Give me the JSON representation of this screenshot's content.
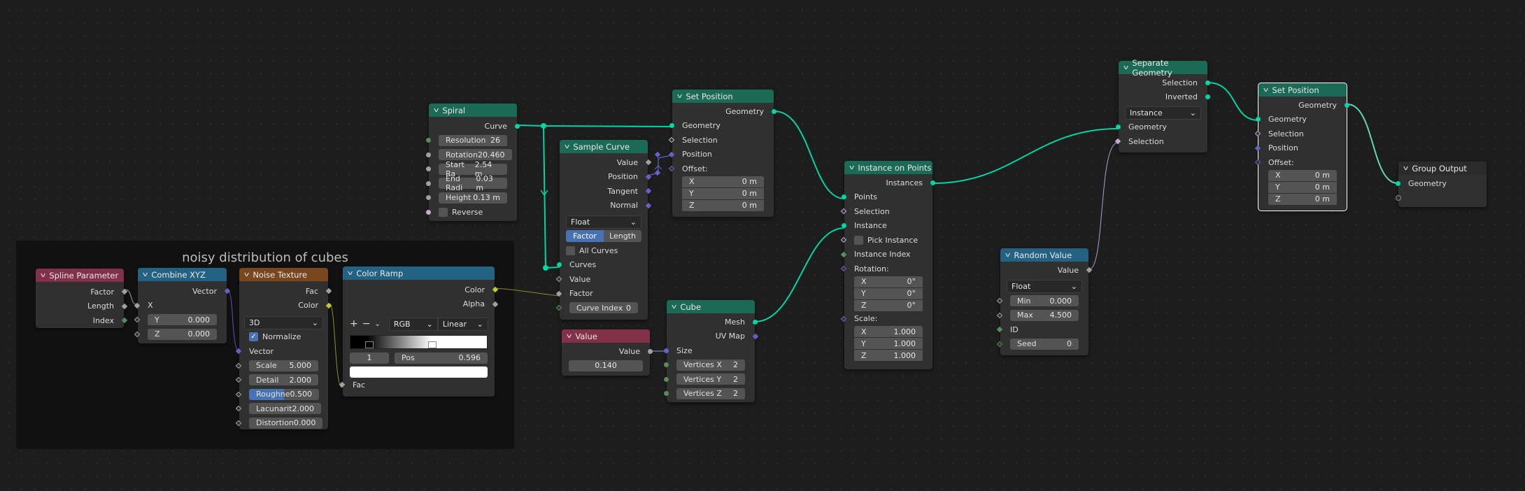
{
  "frame": {
    "label": "noisy distribution of cubes"
  },
  "colors": {
    "geometry_socket": "#00d6a3",
    "vector_socket": "#6363c7",
    "float_socket": "#a1a1a1",
    "int_socket": "#598c5c",
    "bool_socket": "#cca6d6",
    "color_socket": "#c7c729",
    "geometry_header": "#1b6a56",
    "input_header": "#83314a",
    "converter_header": "#246283",
    "texture_header": "#79461d",
    "accent": "#4772b3"
  },
  "nodes": {
    "spline_parameter": {
      "title": "Spline Parameter",
      "outputs": [
        "Factor",
        "Length",
        "Index"
      ]
    },
    "combine_xyz": {
      "title": "Combine XYZ",
      "output": "Vector",
      "x_label": "X",
      "fields": [
        {
          "label": "Y",
          "value": "0.000"
        },
        {
          "label": "Z",
          "value": "0.000"
        }
      ]
    },
    "noise_texture": {
      "title": "Noise Texture",
      "outputs": [
        "Fac",
        "Color"
      ],
      "dimensions": "3D",
      "normalize_label": "Normalize",
      "normalize": true,
      "vector_label": "Vector",
      "fields": [
        {
          "label": "Scale",
          "value": "5.000"
        },
        {
          "label": "Detail",
          "value": "2.000"
        },
        {
          "label": "Roughne",
          "value": "0.500"
        },
        {
          "label": "Lacunarit",
          "value": "2.000"
        },
        {
          "label": "Distortion",
          "value": "0.000"
        }
      ]
    },
    "color_ramp": {
      "title": "Color Ramp",
      "outputs": [
        "Color",
        "Alpha"
      ],
      "add": "+",
      "remove": "−",
      "color_mode": "RGB",
      "interpolation": "Linear",
      "stop_index": "1",
      "pos_label": "Pos",
      "pos_value": "0.596",
      "stops": [
        0.12,
        0.596
      ],
      "input": "Fac"
    },
    "spiral": {
      "title": "Spiral",
      "output": "Curve",
      "fields": [
        {
          "label": "Resolution",
          "value": "26"
        },
        {
          "label": "Rotation",
          "value": "20.460"
        },
        {
          "label": "Start Ra",
          "value": "2.54 m"
        },
        {
          "label": "End Radi",
          "value": "0.03 m"
        },
        {
          "label": "Height",
          "value": "0.13 m"
        }
      ],
      "reverse_label": "Reverse",
      "reverse": false
    },
    "sample_curve": {
      "title": "Sample Curve",
      "outputs": [
        "Value",
        "Position",
        "Tangent",
        "Normal"
      ],
      "data_type": "Float",
      "modes": [
        "Factor",
        "Length"
      ],
      "active_mode": "Factor",
      "all_curves_label": "All Curves",
      "all_curves": false,
      "inputs": [
        "Curves",
        "Value",
        "Factor"
      ],
      "curve_index_label": "Curve Index",
      "curve_index": "0"
    },
    "value": {
      "title": "Value",
      "output": "Value",
      "value": "0.140"
    },
    "cube": {
      "title": "Cube",
      "outputs": [
        "Mesh",
        "UV Map"
      ],
      "size_label": "Size",
      "fields": [
        {
          "label": "Vertices X",
          "value": "2"
        },
        {
          "label": "Vertices Y",
          "value": "2"
        },
        {
          "label": "Vertices Z",
          "value": "2"
        }
      ]
    },
    "set_position_1": {
      "title": "Set Position",
      "output": "Geometry",
      "inputs": [
        "Geometry",
        "Selection",
        "Position",
        "Offset:"
      ],
      "offset": [
        {
          "label": "X",
          "value": "0 m"
        },
        {
          "label": "Y",
          "value": "0 m"
        },
        {
          "label": "Z",
          "value": "0 m"
        }
      ]
    },
    "instance_on_points": {
      "title": "Instance on Points",
      "output": "Instances",
      "inputs": [
        "Points",
        "Selection",
        "Instance"
      ],
      "pick_instance_label": "Pick Instance",
      "pick_instance": false,
      "instance_index_label": "Instance Index",
      "rotation_label": "Rotation:",
      "rotation": [
        {
          "label": "X",
          "value": "0°"
        },
        {
          "label": "Y",
          "value": "0°"
        },
        {
          "label": "Z",
          "value": "0°"
        }
      ],
      "scale_label": "Scale:",
      "scale": [
        {
          "label": "X",
          "value": "1.000"
        },
        {
          "label": "Y",
          "value": "1.000"
        },
        {
          "label": "Z",
          "value": "1.000"
        }
      ]
    },
    "random_value": {
      "title": "Random Value",
      "output": "Value",
      "data_type": "Float",
      "fields": [
        {
          "label": "Min",
          "value": "0.000"
        },
        {
          "label": "Max",
          "value": "4.500"
        }
      ],
      "id_label": "ID",
      "seed_label": "Seed",
      "seed": "0"
    },
    "separate_geometry": {
      "title": "Separate Geometry",
      "outputs": [
        "Selection",
        "Inverted"
      ],
      "domain": "Instance",
      "inputs": [
        "Geometry",
        "Selection"
      ]
    },
    "set_position_2": {
      "title": "Set Position",
      "output": "Geometry",
      "inputs": [
        "Geometry",
        "Selection",
        "Position",
        "Offset:"
      ],
      "offset": [
        {
          "label": "X",
          "value": "0 m"
        },
        {
          "label": "Y",
          "value": "0 m"
        },
        {
          "label": "Z",
          "value": "0 m"
        }
      ]
    },
    "group_output": {
      "title": "Group Output",
      "input": "Geometry"
    }
  }
}
